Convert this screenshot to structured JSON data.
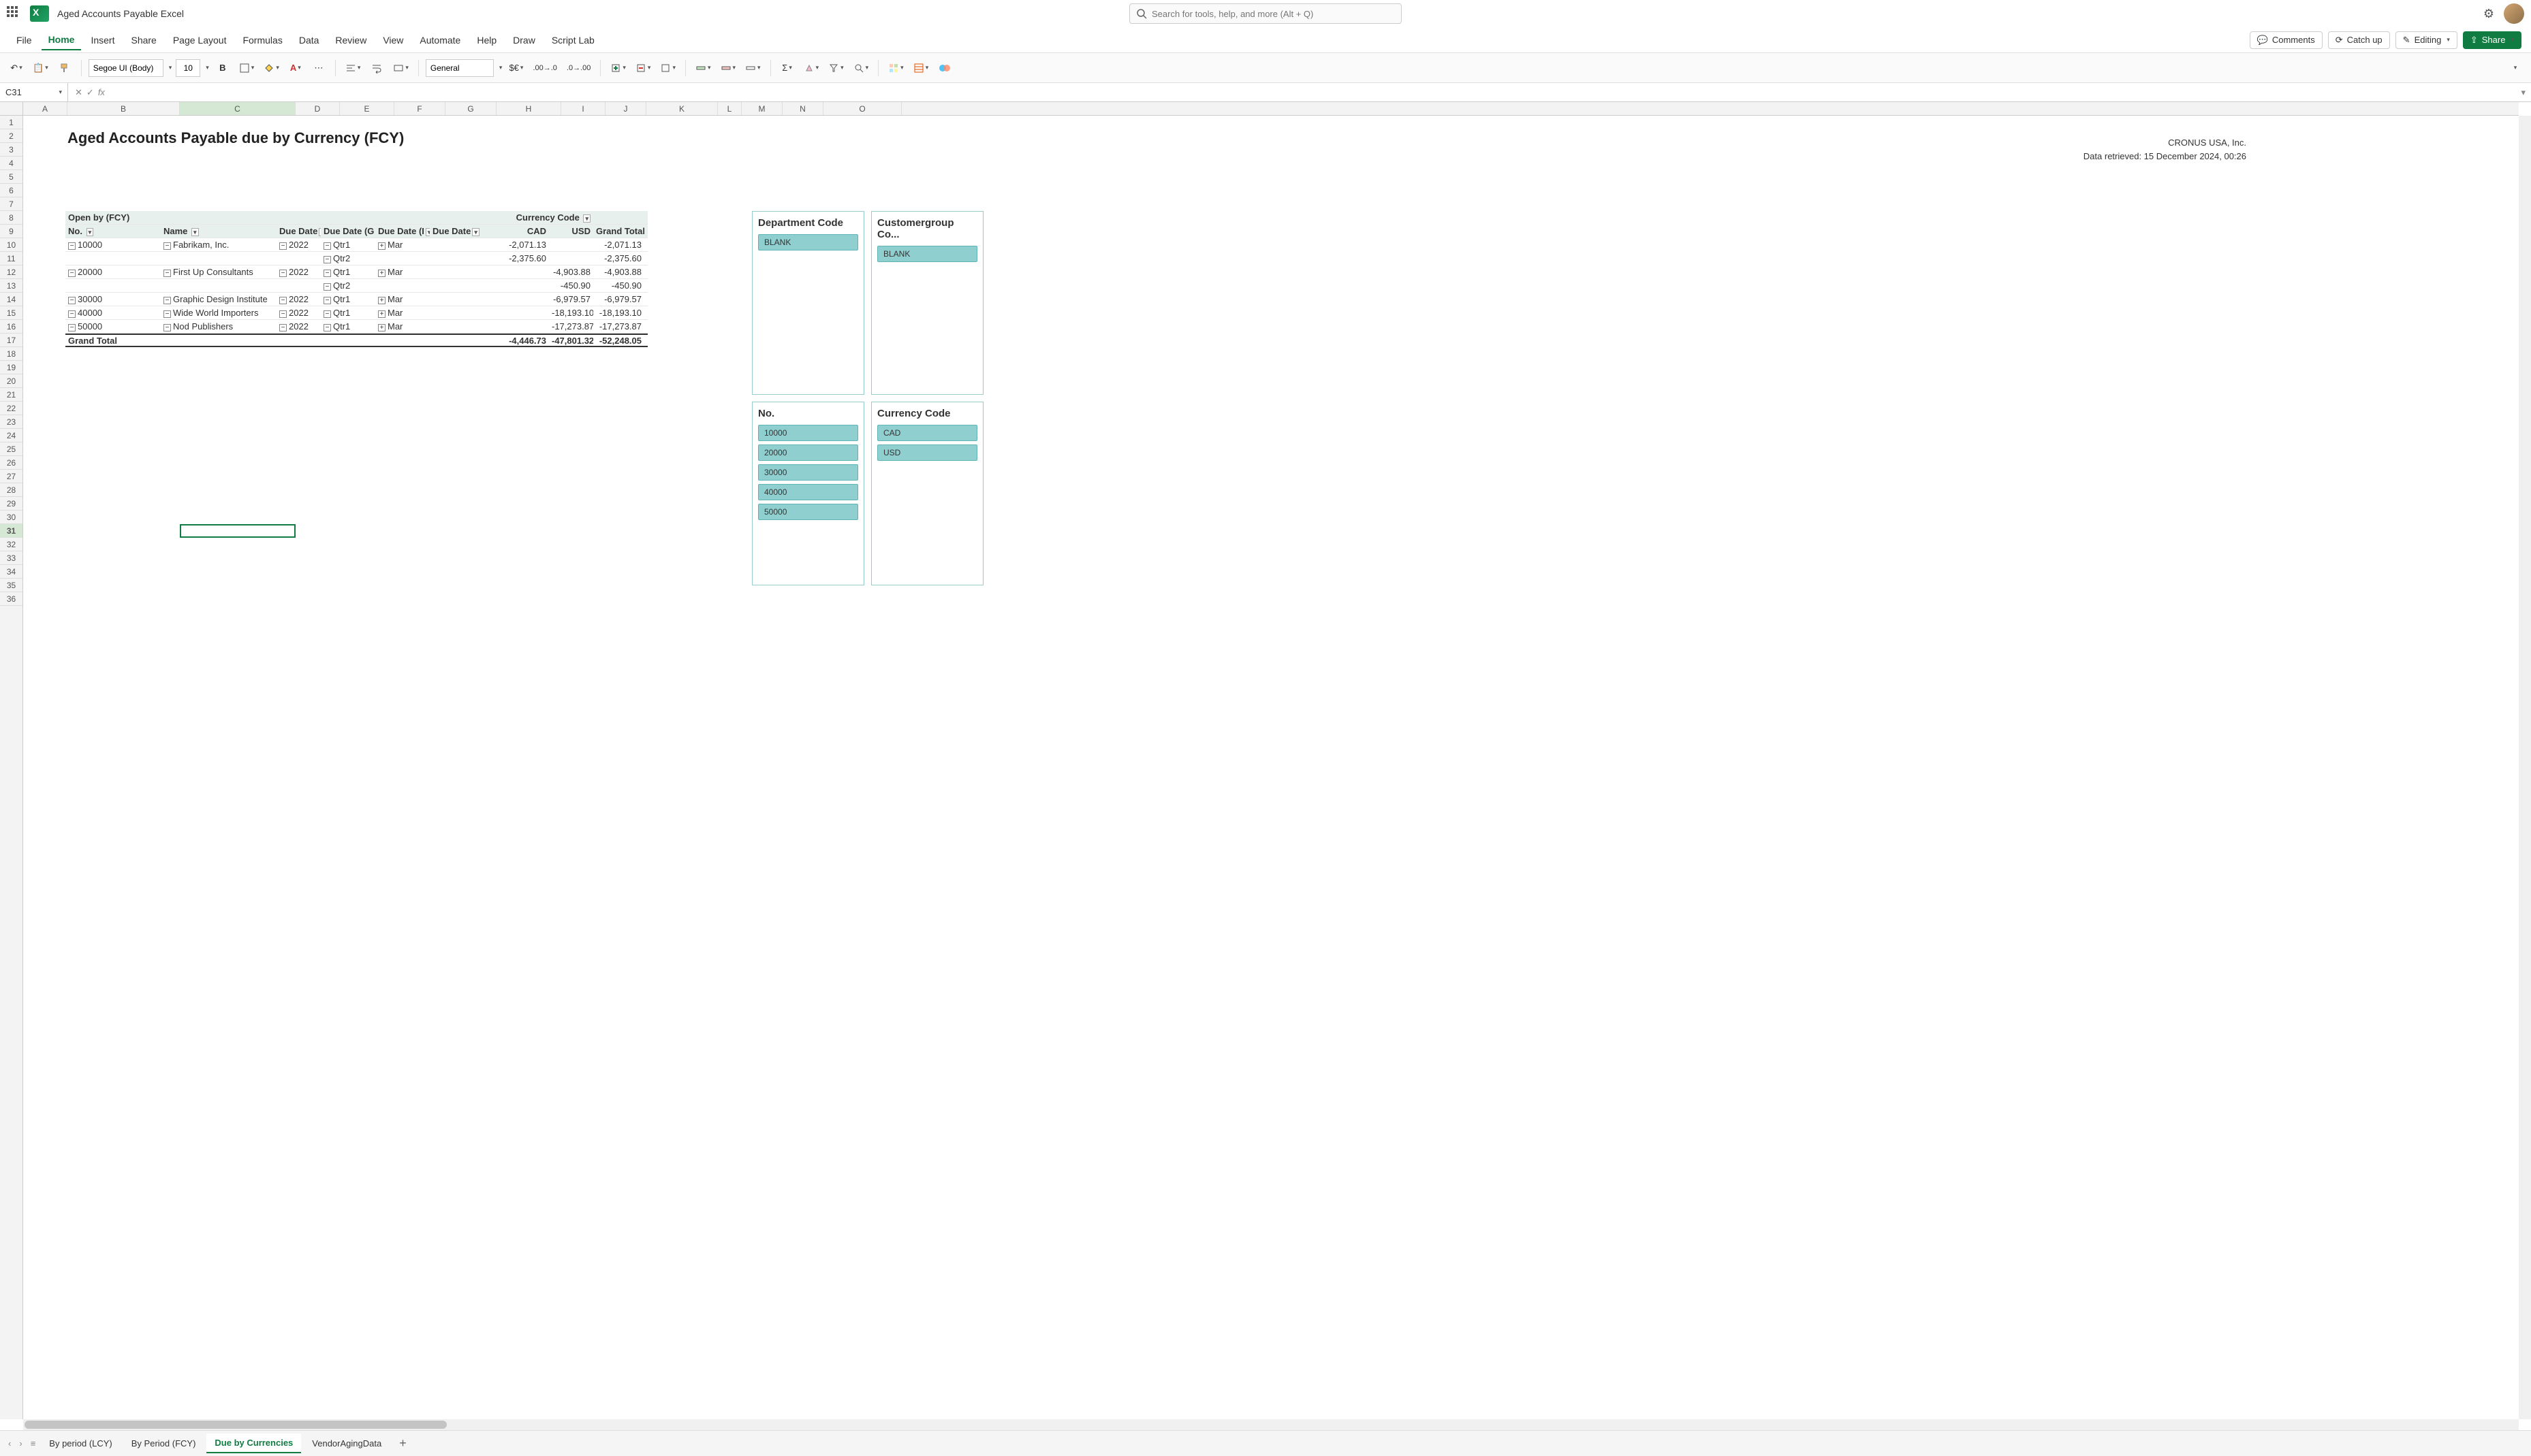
{
  "titlebar": {
    "doc_title": "Aged Accounts Payable Excel",
    "search_placeholder": "Search for tools, help, and more (Alt + Q)"
  },
  "menu": {
    "items": [
      "File",
      "Home",
      "Insert",
      "Share",
      "Page Layout",
      "Formulas",
      "Data",
      "Review",
      "View",
      "Automate",
      "Help",
      "Draw",
      "Script Lab"
    ],
    "active": "Home",
    "comments": "Comments",
    "catchup": "Catch up",
    "editing": "Editing",
    "share": "Share"
  },
  "ribbon": {
    "font_name": "Segoe UI (Body)",
    "font_size": "10",
    "number_format": "General"
  },
  "formula_bar": {
    "name_box": "C31"
  },
  "columns": [
    "A",
    "B",
    "C",
    "D",
    "E",
    "F",
    "G",
    "H",
    "I",
    "J",
    "K",
    "L",
    "M",
    "N",
    "O"
  ],
  "selected_col": "C",
  "rows_count": 36,
  "selected_row": 31,
  "report": {
    "title": "Aged Accounts Payable due by Currency (FCY)",
    "company": "CRONUS USA, Inc.",
    "retrieved": "Data retrieved: 15 December 2024, 00:26"
  },
  "pivot": {
    "open_label": "Open by (FCY)",
    "currency_label": "Currency Code",
    "headers": {
      "no": "No.",
      "name": "Name",
      "dd1": "Due Date",
      "dd2": "Due Date (G",
      "dd3": "Due Date (I",
      "dd4": "Due Date",
      "cad": "CAD",
      "usd": "USD",
      "gt": "Grand Total"
    },
    "rows": [
      {
        "no": "10000",
        "name": "Fabrikam, Inc.",
        "year": "2022",
        "qtr": "Qtr1",
        "mon": "Mar",
        "cad": "-2,071.13",
        "usd": "",
        "gt": "-2,071.13"
      },
      {
        "no": "",
        "name": "",
        "year": "",
        "qtr": "Qtr2",
        "mon": "",
        "cad": "-2,375.60",
        "usd": "",
        "gt": "-2,375.60"
      },
      {
        "no": "20000",
        "name": "First Up Consultants",
        "year": "2022",
        "qtr": "Qtr1",
        "mon": "Mar",
        "cad": "",
        "usd": "-4,903.88",
        "gt": "-4,903.88"
      },
      {
        "no": "",
        "name": "",
        "year": "",
        "qtr": "Qtr2",
        "mon": "",
        "cad": "",
        "usd": "-450.90",
        "gt": "-450.90"
      },
      {
        "no": "30000",
        "name": "Graphic Design Institute",
        "year": "2022",
        "qtr": "Qtr1",
        "mon": "Mar",
        "cad": "",
        "usd": "-6,979.57",
        "gt": "-6,979.57"
      },
      {
        "no": "40000",
        "name": "Wide World Importers",
        "year": "2022",
        "qtr": "Qtr1",
        "mon": "Mar",
        "cad": "",
        "usd": "-18,193.10",
        "gt": "-18,193.10"
      },
      {
        "no": "50000",
        "name": "Nod Publishers",
        "year": "2022",
        "qtr": "Qtr1",
        "mon": "Mar",
        "cad": "",
        "usd": "-17,273.87",
        "gt": "-17,273.87"
      }
    ],
    "total": {
      "label": "Grand Total",
      "cad": "-4,446.73",
      "usd": "-47,801.32",
      "gt": "-52,248.05"
    }
  },
  "slicers": {
    "dept": {
      "title": "Department Code",
      "items": [
        "BLANK"
      ]
    },
    "custgrp": {
      "title": "Customergroup Co...",
      "items": [
        "BLANK"
      ]
    },
    "no": {
      "title": "No.",
      "items": [
        "10000",
        "20000",
        "30000",
        "40000",
        "50000"
      ]
    },
    "curr": {
      "title": "Currency Code",
      "items": [
        "CAD",
        "USD"
      ]
    }
  },
  "sheets": {
    "tabs": [
      "By period (LCY)",
      "By Period (FCY)",
      "Due by Currencies",
      "VendorAgingData"
    ],
    "active": "Due by Currencies"
  }
}
